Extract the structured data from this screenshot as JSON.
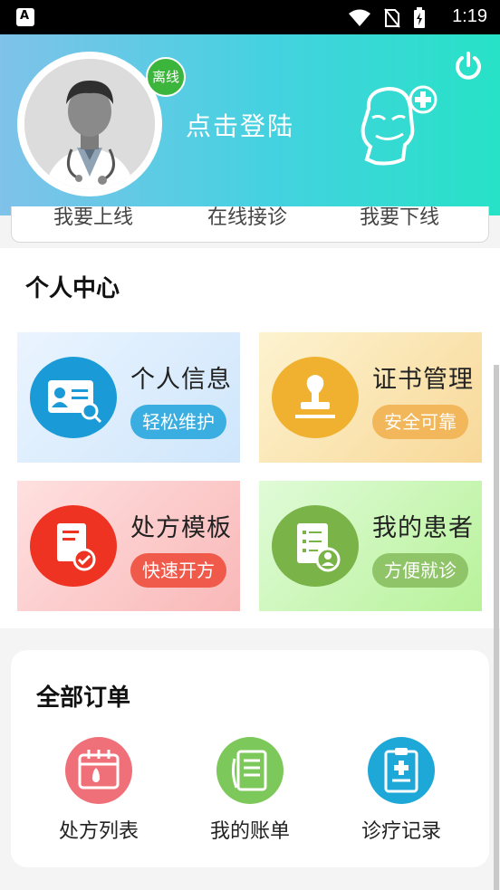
{
  "status_bar": {
    "time": "1:19",
    "left_icon": "A"
  },
  "header": {
    "status_badge": "离线",
    "login_prompt": "点击登陆",
    "icons": [
      "avatar-doctor",
      "power-icon",
      "doctor-plus-logo"
    ]
  },
  "tabs": [
    {
      "label": "我要上线"
    },
    {
      "label": "在线接诊"
    },
    {
      "label": "我要下线"
    }
  ],
  "personal_center": {
    "title": "个人中心",
    "cards": [
      {
        "title": "个人信息",
        "tag": "轻松维护",
        "icon": "id-card-search-icon",
        "accent": "#1a9bd8"
      },
      {
        "title": "证书管理",
        "tag": "安全可靠",
        "icon": "stamp-icon",
        "accent": "#f0b030"
      },
      {
        "title": "处方模板",
        "tag": "快速开方",
        "icon": "prescription-check-icon",
        "accent": "#ee3322"
      },
      {
        "title": "我的患者",
        "tag": "方便就诊",
        "icon": "patient-list-icon",
        "accent": "#7ab348"
      }
    ]
  },
  "orders": {
    "title": "全部订单",
    "items": [
      {
        "label": "处方列表",
        "icon": "calendar-drop-icon",
        "color": "#f0707a"
      },
      {
        "label": "我的账单",
        "icon": "bill-icon",
        "color": "#7dc85a"
      },
      {
        "label": "诊疗记录",
        "icon": "clipboard-medical-icon",
        "color": "#1ea8d8"
      }
    ]
  }
}
